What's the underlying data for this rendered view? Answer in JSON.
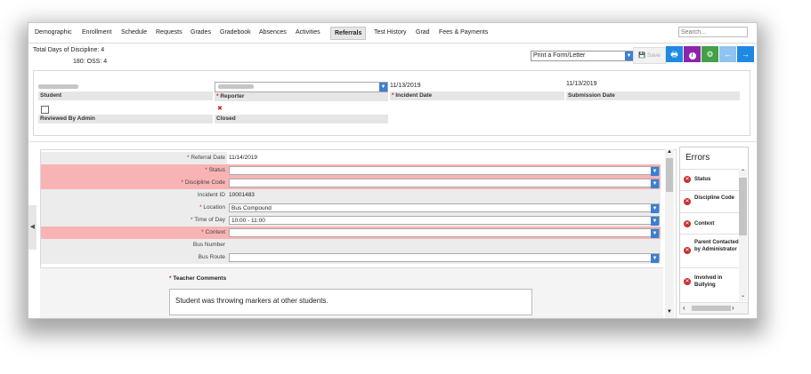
{
  "tabs": [
    "Demographic",
    "Enrollment",
    "Schedule",
    "Requests",
    "Grades",
    "Gradebook",
    "Absences",
    "Activities",
    "Referrals",
    "Test History",
    "Grad",
    "Fees & Payments"
  ],
  "active_tab": "Referrals",
  "search": {
    "placeholder": "Search..."
  },
  "discipline": {
    "total_line": "Total Days of Discipline:  4",
    "oss_line": "180: OSS: 4"
  },
  "print_select": {
    "value": "Print a Form/Letter"
  },
  "toolbar": {
    "save_label": "Save"
  },
  "header": {
    "student_label": "Student",
    "reporter_label": "Reporter",
    "incident_date_label": "Incident Date",
    "incident_date_value": "11/13/2019",
    "submission_date_label": "Submission Date",
    "submission_date_value": "11/13/2019",
    "reviewed_label": "Reviewed By Admin",
    "closed_label": "Closed",
    "closed_mark": "✖"
  },
  "form": {
    "referral_date_label": "Referral Date",
    "referral_date_value": "11/14/2019",
    "status_label": "Status",
    "discipline_code_label": "Discipline Code",
    "incident_id_label": "Incident ID",
    "incident_id_value": "10001483",
    "location_label": "Location",
    "location_value": "Bus Compound",
    "time_of_day_label": "Time of Day",
    "time_of_day_value": "10:00 - 11:00",
    "context_label": "Context",
    "bus_number_label": "Bus Number",
    "bus_route_label": "Bus Route",
    "teacher_comments_label": "Teacher Comments",
    "teacher_comments_value": "Student was throwing markers at other students."
  },
  "errors": {
    "title": "Errors",
    "items": [
      "Status",
      "Discipline Code",
      "Context",
      "Parent Contacted by Administrator",
      "Involved in Bullying"
    ]
  },
  "colors": {
    "accent_blue": "#1e88e5",
    "purple": "#8e24aa",
    "green": "#43a047",
    "light_blue": "#90c4f0",
    "error_red": "#f8b4b4"
  }
}
